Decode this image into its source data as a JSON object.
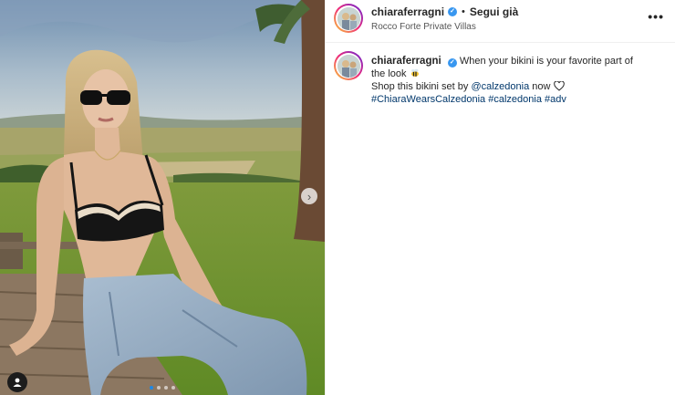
{
  "header": {
    "username": "chiaraferragni",
    "separator": "•",
    "follow_label": "Segui già",
    "location": "Rocco Forte Private Villas",
    "more_label": "•••"
  },
  "caption": {
    "username": "chiaraferragni",
    "text_line1": "When your bikini is your favorite part of the look",
    "emoji": "bee-emoji",
    "text_line2_prefix": "Shop this bikini set by",
    "mention": "@calzedonia",
    "text_line2_suffix": "now",
    "hashtags": [
      "#ChiaraWearsCalzedonia",
      "#calzedonia",
      "#adv"
    ]
  },
  "carousel": {
    "current_index": 1,
    "total": 4,
    "next_icon": "chevron-right-icon"
  },
  "colors": {
    "link": "#00376b",
    "verified": "#3897f0",
    "carousel_active_dot": "#1e88e5"
  }
}
